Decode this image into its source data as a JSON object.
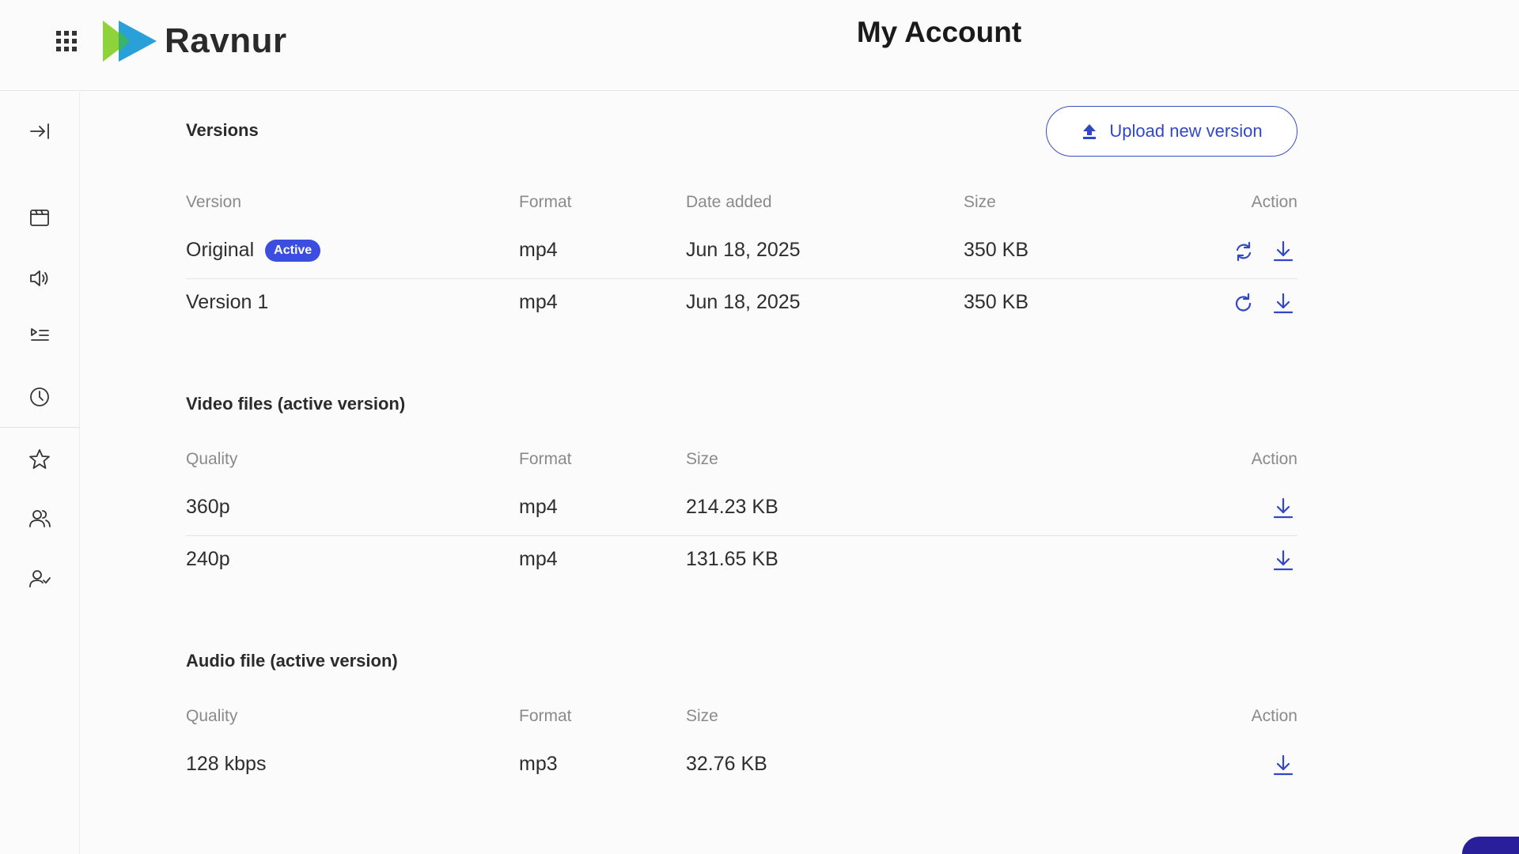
{
  "header": {
    "brand": "Ravnur",
    "title": "My Account"
  },
  "sidebar": {
    "items": [
      {
        "icon": "collapse-icon"
      },
      {
        "icon": "media-icon"
      },
      {
        "icon": "audio-icon"
      },
      {
        "icon": "playlist-icon"
      },
      {
        "icon": "history-icon"
      },
      {
        "icon": "favorites-icon"
      },
      {
        "icon": "groups-icon"
      },
      {
        "icon": "user-check-icon"
      }
    ]
  },
  "versions": {
    "title": "Versions",
    "upload_label": "Upload new version",
    "columns": [
      "Version",
      "Format",
      "Date added",
      "Size",
      "Action"
    ],
    "rows": [
      {
        "version": "Original",
        "badge": "Active",
        "format": "mp4",
        "date": "Jun 18, 2025",
        "size": "350 KB"
      },
      {
        "version": "Version 1",
        "badge": "",
        "format": "mp4",
        "date": "Jun 18, 2025",
        "size": "350 KB"
      }
    ]
  },
  "video_files": {
    "title": "Video files (active version)",
    "columns": [
      "Quality",
      "Format",
      "Size",
      "Action"
    ],
    "rows": [
      {
        "quality": "360p",
        "format": "mp4",
        "size": "214.23 KB"
      },
      {
        "quality": "240p",
        "format": "mp4",
        "size": "131.65 KB"
      }
    ]
  },
  "audio_file": {
    "title": "Audio file (active version)",
    "columns": [
      "Quality",
      "Format",
      "Size",
      "Action"
    ],
    "rows": [
      {
        "quality": "128 kbps",
        "format": "mp3",
        "size": "32.76 KB"
      }
    ]
  },
  "colors": {
    "accent": "#3147c9",
    "badge": "#3b4ee0"
  }
}
